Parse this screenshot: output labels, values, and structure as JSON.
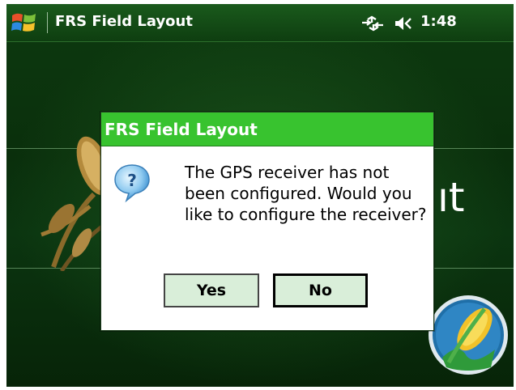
{
  "taskbar": {
    "title": "FRS Field Layout",
    "time": "1:48",
    "icons": [
      "windows-start-icon",
      "connectivity-icon",
      "volume-icon"
    ]
  },
  "background_app": {
    "partial_title_text": "ıt"
  },
  "dialog": {
    "title": "FRS Field Layout",
    "icon": "question-bubble-icon",
    "message": "The GPS receiver has not been configured. Would you like to configure the receiver?",
    "buttons": {
      "yes_label": "Yes",
      "no_label": "No"
    }
  },
  "colors": {
    "taskbar_bg": "#124a14",
    "dialog_titlebar": "#38c32f",
    "button_bg": "#d9eed9",
    "screen_bg": "#0a2f0c"
  }
}
